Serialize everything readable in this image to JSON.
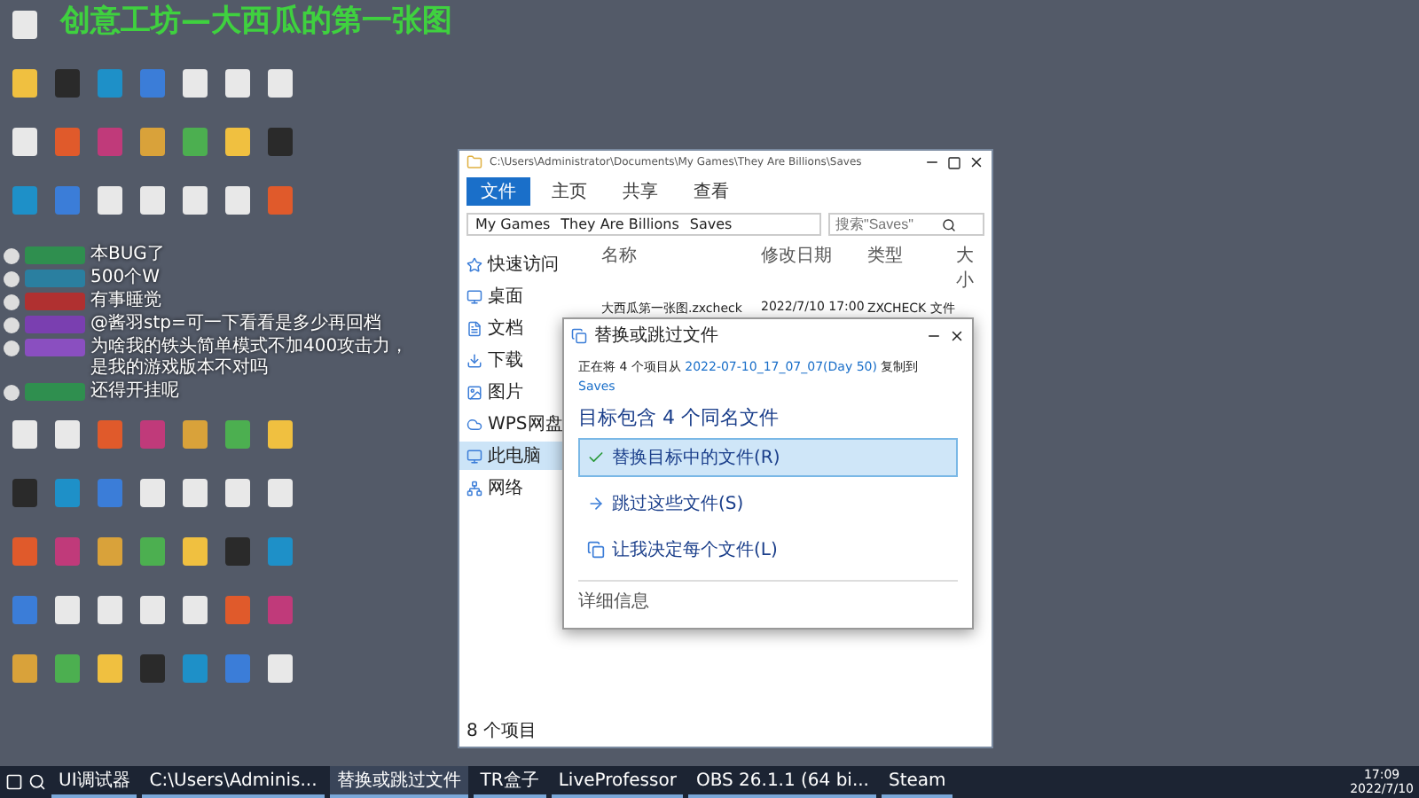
{
  "stream_title": "创意工坊—大西瓜的第一张图",
  "chat": [
    {
      "text": "本BUG了",
      "color": "#2f8f4f"
    },
    {
      "text": "500个W",
      "color": "#2a7fa0"
    },
    {
      "text": "有事睡觉",
      "color": "#b03030"
    },
    {
      "text": "@酱羽stp=可一下看看是多少再回档",
      "color": "#7a3fb0"
    },
    {
      "text": "为啥我的铁头简单模式不加400攻击力，是我的游戏版本不对吗",
      "color": "#8a4fc0"
    },
    {
      "text": "还得开挂呢",
      "color": "#2f8f4f"
    }
  ],
  "explorer": {
    "title": "C:\\Users\\Administrator\\Documents\\My Games\\They Are Billions\\Saves",
    "ribbon_tabs": [
      {
        "label": "文件",
        "selected": true
      },
      {
        "label": "主页",
        "selected": false
      },
      {
        "label": "共享",
        "selected": false
      },
      {
        "label": "查看",
        "selected": false
      }
    ],
    "breadcrumb": [
      "My Games",
      "They Are Billions",
      "Saves"
    ],
    "search": {
      "placeholder": "搜索\"Saves\""
    },
    "sidebar": [
      {
        "label": "快速访问",
        "selected": false
      },
      {
        "label": "桌面",
        "selected": false
      },
      {
        "label": "文档",
        "selected": false
      },
      {
        "label": "下载",
        "selected": false
      },
      {
        "label": "图片",
        "selected": false
      },
      {
        "label": "WPS网盘",
        "selected": false
      },
      {
        "label": "此电脑",
        "selected": true
      },
      {
        "label": "网络",
        "selected": false
      }
    ],
    "columns": [
      "名称",
      "修改日期",
      "类型",
      "大小"
    ],
    "rows": [
      {
        "name": "大西瓜第一张图.zxcheck",
        "date": "2022/7/10 17:00",
        "type": "ZXCHECK 文件"
      }
    ],
    "status": "8 个项目"
  },
  "dialog": {
    "title": "替换或跳过文件",
    "copy_prefix": "正在将 4 个项目从",
    "source": "2022-07-10_17_07_07(Day 50)",
    "copy_mid": "复制到",
    "target": "Saves",
    "heading": "目标包含 4 个同名文件",
    "options": [
      {
        "label": "替换目标中的文件(R)",
        "selected": true,
        "kind": "replace"
      },
      {
        "label": "跳过这些文件(S)",
        "selected": false,
        "kind": "skip"
      },
      {
        "label": "让我决定每个文件(L)",
        "selected": false,
        "kind": "decide"
      }
    ],
    "details": "详细信息"
  },
  "taskbar": {
    "items": [
      {
        "label": "UI调试器",
        "selected": false
      },
      {
        "label": "C:\\Users\\Adminis...",
        "selected": false
      },
      {
        "label": "替换或跳过文件",
        "selected": true
      },
      {
        "label": "TR盒子",
        "selected": false
      },
      {
        "label": "LiveProfessor",
        "selected": false
      },
      {
        "label": "OBS 26.1.1 (64 bi...",
        "selected": false
      },
      {
        "label": "Steam",
        "selected": false
      }
    ],
    "time": "17:09",
    "date": "2022/7/10"
  }
}
